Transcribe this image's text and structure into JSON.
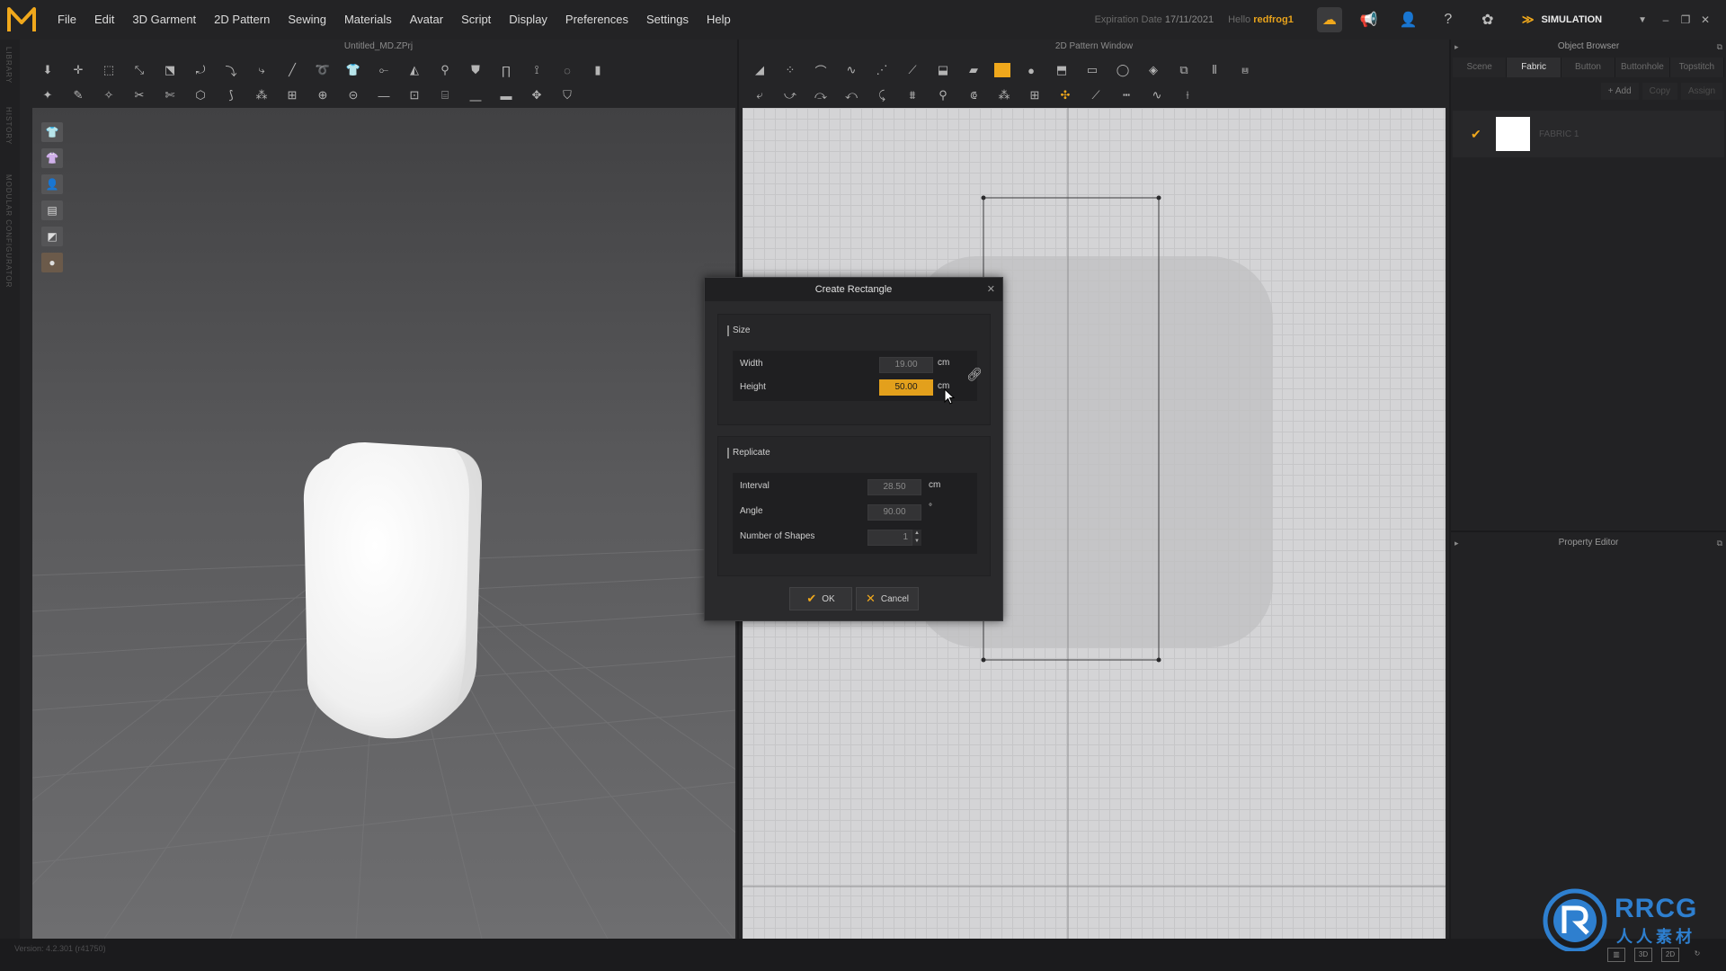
{
  "app": {
    "menu": [
      "File",
      "Edit",
      "3D Garment",
      "2D Pattern",
      "Sewing",
      "Materials",
      "Avatar",
      "Script",
      "Display",
      "Preferences",
      "Settings",
      "Help"
    ],
    "expiration_label": "Expiration Date",
    "expiration_date": "17/11/2021",
    "hello_label": "Hello",
    "username": "redfrog1",
    "simulation_label": "SIMULATION",
    "accent_color": "#f0a81c"
  },
  "left_strip": [
    "LIBRARY",
    "HISTORY",
    "MODULAR CONFIGURATOR"
  ],
  "window3d": {
    "title": "Untitled_MD.ZPrj"
  },
  "window2d": {
    "title": "2D Pattern Window"
  },
  "object_browser": {
    "title": "Object Browser",
    "tabs": [
      "Scene",
      "Fabric",
      "Button",
      "Buttonhole",
      "Topstitch"
    ],
    "active_tab": "Fabric",
    "actions": [
      "+ Add",
      "Copy",
      "Assign"
    ],
    "fabric_name": "FABRIC 1"
  },
  "property_editor": {
    "title": "Property Editor"
  },
  "dialog": {
    "title": "Create Rectangle",
    "size_group": "Size",
    "width_label": "Width",
    "width_value": "19.00",
    "width_unit": "cm",
    "height_label": "Height",
    "height_value": "50.00",
    "height_unit": "cm",
    "replicate_group": "Replicate",
    "interval_label": "Interval",
    "interval_value": "28.50",
    "interval_unit": "cm",
    "angle_label": "Angle",
    "angle_value": "90.00",
    "angle_unit": "°",
    "shapes_label": "Number of Shapes",
    "shapes_value": "1",
    "ok_label": "OK",
    "cancel_label": "Cancel"
  },
  "status": {
    "version": "Version: 4.2.301 (r41750)",
    "view_buttons": [
      "3D",
      "2D"
    ]
  },
  "watermark": {
    "line1": "RRCG",
    "line2": "人人素材"
  }
}
